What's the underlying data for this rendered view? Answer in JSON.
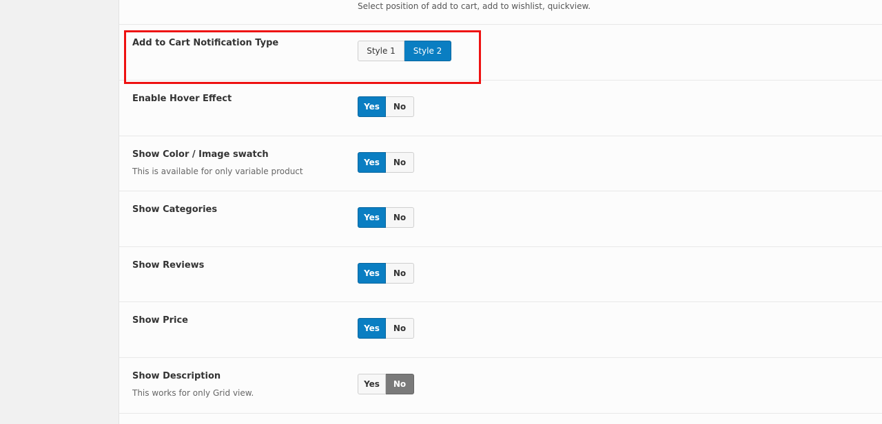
{
  "top": {
    "description": "Select position of add to cart, add to wishlist, quickview."
  },
  "colors": {
    "accent_blue": "#0a7ec2",
    "inactive_dark": "#7a7a7a",
    "highlight_red": "#ee1111"
  },
  "settings": [
    {
      "title": "Add to Cart Notification Type",
      "subtitle": "",
      "options": [
        "Style 1",
        "Style 2"
      ],
      "selected": "Style 2"
    },
    {
      "title": "Enable Hover Effect",
      "subtitle": "",
      "options": [
        "Yes",
        "No"
      ],
      "selected": "Yes"
    },
    {
      "title": "Show Color / Image swatch",
      "subtitle": "This is available for only variable product",
      "options": [
        "Yes",
        "No"
      ],
      "selected": "Yes"
    },
    {
      "title": "Show Categories",
      "subtitle": "",
      "options": [
        "Yes",
        "No"
      ],
      "selected": "Yes"
    },
    {
      "title": "Show Reviews",
      "subtitle": "",
      "options": [
        "Yes",
        "No"
      ],
      "selected": "Yes"
    },
    {
      "title": "Show Price",
      "subtitle": "",
      "options": [
        "Yes",
        "No"
      ],
      "selected": "Yes"
    },
    {
      "title": "Show Description",
      "subtitle": "This works for only Grid view.",
      "options": [
        "Yes",
        "No"
      ],
      "selected": "No"
    }
  ]
}
